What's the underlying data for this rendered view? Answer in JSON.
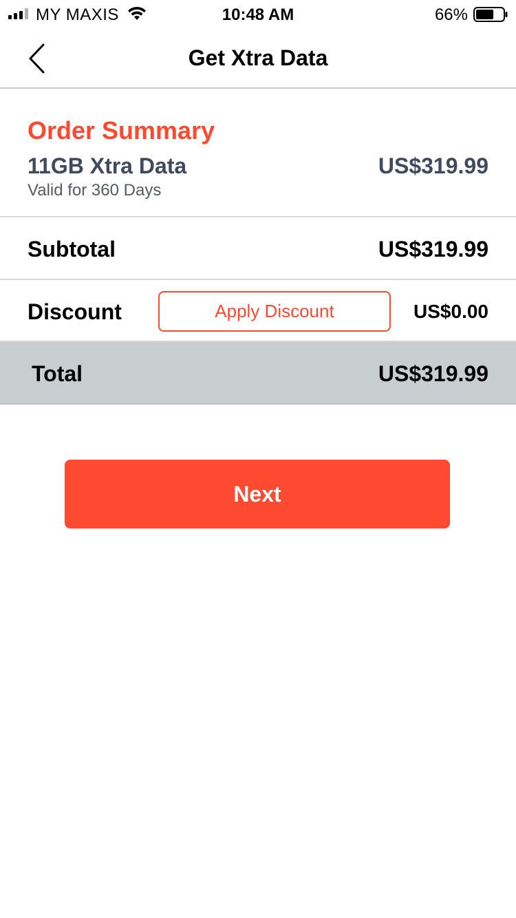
{
  "status_bar": {
    "carrier": "MY MAXIS",
    "time": "10:48 AM",
    "battery_percent": "66%",
    "battery_level": 0.66,
    "signal_icon": "signal-bars-icon",
    "wifi_icon": "wifi-icon",
    "battery_icon": "battery-icon"
  },
  "nav": {
    "title": "Get Xtra Data",
    "back_icon": "chevron-left-icon"
  },
  "summary": {
    "title": "Order Summary",
    "product_name": "11GB Xtra Data",
    "validity": "Valid for 360 Days",
    "price": "US$319.99"
  },
  "subtotal": {
    "label": "Subtotal",
    "value": "US$319.99"
  },
  "discount": {
    "label": "Discount",
    "button_label": "Apply Discount",
    "value": "US$0.00"
  },
  "total": {
    "label": "Total",
    "value": "US$319.99"
  },
  "actions": {
    "next_label": "Next"
  },
  "colors": {
    "accent": "#ff4a32",
    "product_text": "#3f4a5e",
    "total_bg": "#c8cdd0"
  }
}
